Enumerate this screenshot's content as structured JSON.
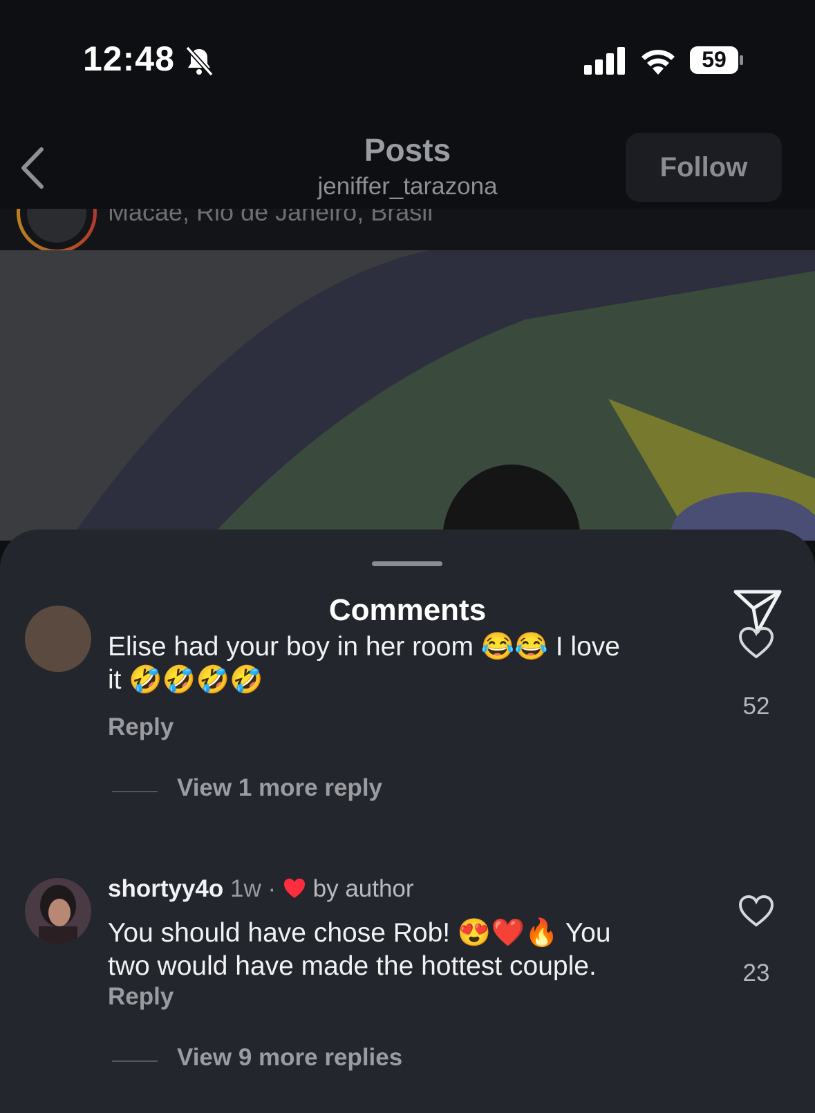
{
  "status_bar": {
    "time": "12:48",
    "battery": "59",
    "icons": [
      "bell-slash-icon",
      "signal-icon",
      "wifi-icon",
      "battery-icon"
    ]
  },
  "header": {
    "title": "Posts",
    "subtitle": "jeniffer_tarazona",
    "follow_label": "Follow",
    "post_location": "Macaé, Rio de Janeiro, Brasil"
  },
  "sheet": {
    "title": "Comments"
  },
  "comments": [
    {
      "text_line1": "Elise had your boy in her room 😂😂 I love",
      "text_line2": "it 🤣🤣🤣🤣",
      "reply": "Reply",
      "likes": "52",
      "view_more": "View 1 more reply"
    },
    {
      "username": "shortyy4o",
      "time": "1w",
      "separator": "·",
      "badge": "by author",
      "text_line1": "You should have chose Rob! 😍❤️🔥 You",
      "text_line2": "two would have made the hottest couple.",
      "reply": "Reply",
      "likes": "23",
      "view_more": "View 9 more replies"
    }
  ],
  "colors": {
    "background": "#0d0f12",
    "sheet": "#23262c",
    "like_red": "#ff2d3d"
  }
}
